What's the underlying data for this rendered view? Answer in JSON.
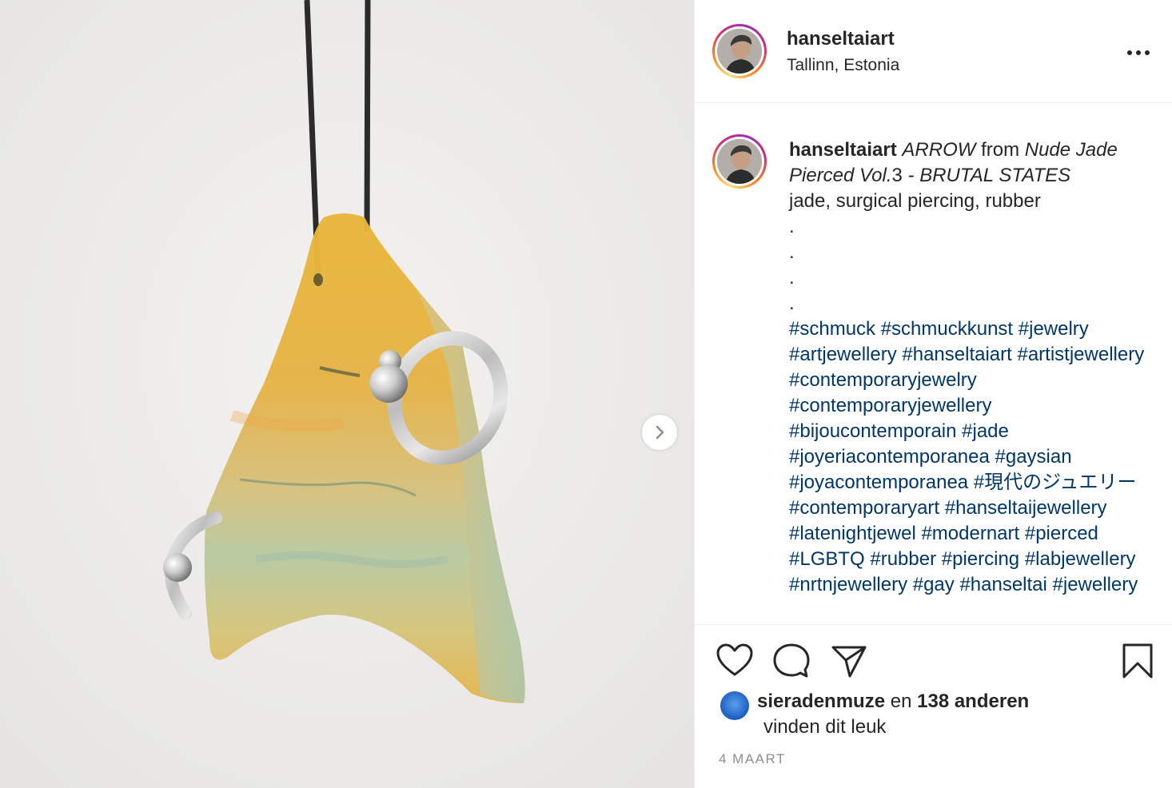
{
  "post": {
    "username": "hanseltaiart",
    "location": "Tallinn, Estonia"
  },
  "caption": {
    "username": "hanseltaiart",
    "title_word": "ARROW",
    "from_word": "from",
    "collection": "Nude Jade Pierced Vol.",
    "volume_num": "3",
    "separator": " - ",
    "subtitle": "BRUTAL STATES",
    "materials": "jade, surgical piercing, rubber",
    "dots": [
      ".",
      ".",
      ".",
      "."
    ],
    "hashtags": "#schmuck #schmuckkunst #jewelry #artjewellery #hanseltaiart #artistjewellery #contemporaryjewelry #contemporaryjewellery #bijoucontemporain #jade #joyeriacontemporanea #gaysian #joyacontemporanea #現代のジュエリー #contemporaryart #hanseltaijewellery #latenightjewel #modernart #pierced #LGBTQ #rubber #piercing #labjewellery #nrtnjewellery #gay #hanseltai #jewellery"
  },
  "likes": {
    "first_liker": "sieradenmuze",
    "connector": "en",
    "others": "138 anderen",
    "suffix": "vinden dit leuk"
  },
  "date": "4 MAART",
  "icons": {
    "more": "more-options-icon",
    "next": "chevron-right-icon",
    "like": "heart-icon",
    "comment": "comment-icon",
    "share": "paper-plane-icon",
    "save": "bookmark-icon"
  },
  "colors": {
    "text": "#262626",
    "hashtag": "#00376b",
    "muted": "#8e8e8e",
    "border": "#efefef"
  }
}
